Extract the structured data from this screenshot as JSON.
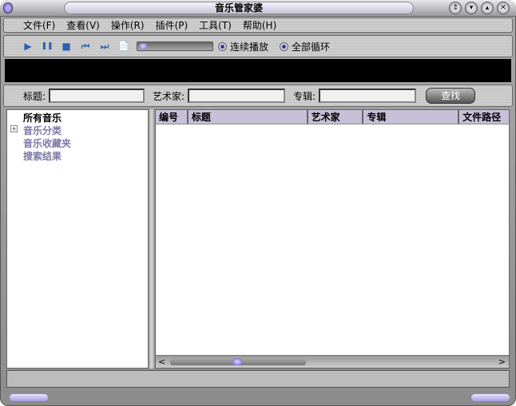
{
  "window": {
    "title": "音乐管家婆",
    "buttons": [
      "⇕",
      "▾",
      "▴",
      "✕"
    ]
  },
  "menu": [
    "文件(F)",
    "查看(V)",
    "操作(R)",
    "插件(P)",
    "工具(T)",
    "帮助(H)"
  ],
  "toolbar": {
    "icons": [
      "play-icon",
      "pause-icon",
      "stop-icon",
      "previous-icon",
      "next-icon",
      "playlist-edit-icon"
    ],
    "glyphs": [
      "▶",
      "❚❚",
      "■",
      "⏮",
      "⏭",
      "📄"
    ],
    "continuous_play": "连续播放",
    "loop_all": "全部循环"
  },
  "search": {
    "title_label": "标题:",
    "artist_label": "艺术家:",
    "album_label": "专辑:",
    "title_value": "",
    "artist_value": "",
    "album_value": "",
    "find_button": "查找"
  },
  "tree": [
    {
      "label": "所有音乐",
      "selected": true
    },
    {
      "label": "音乐分类",
      "expander": "+"
    },
    {
      "label": "音乐收藏夹"
    },
    {
      "label": "搜索结果"
    }
  ],
  "list": {
    "columns": [
      "编号",
      "标题",
      "艺术家",
      "专辑",
      "文件路径"
    ],
    "rows": []
  }
}
